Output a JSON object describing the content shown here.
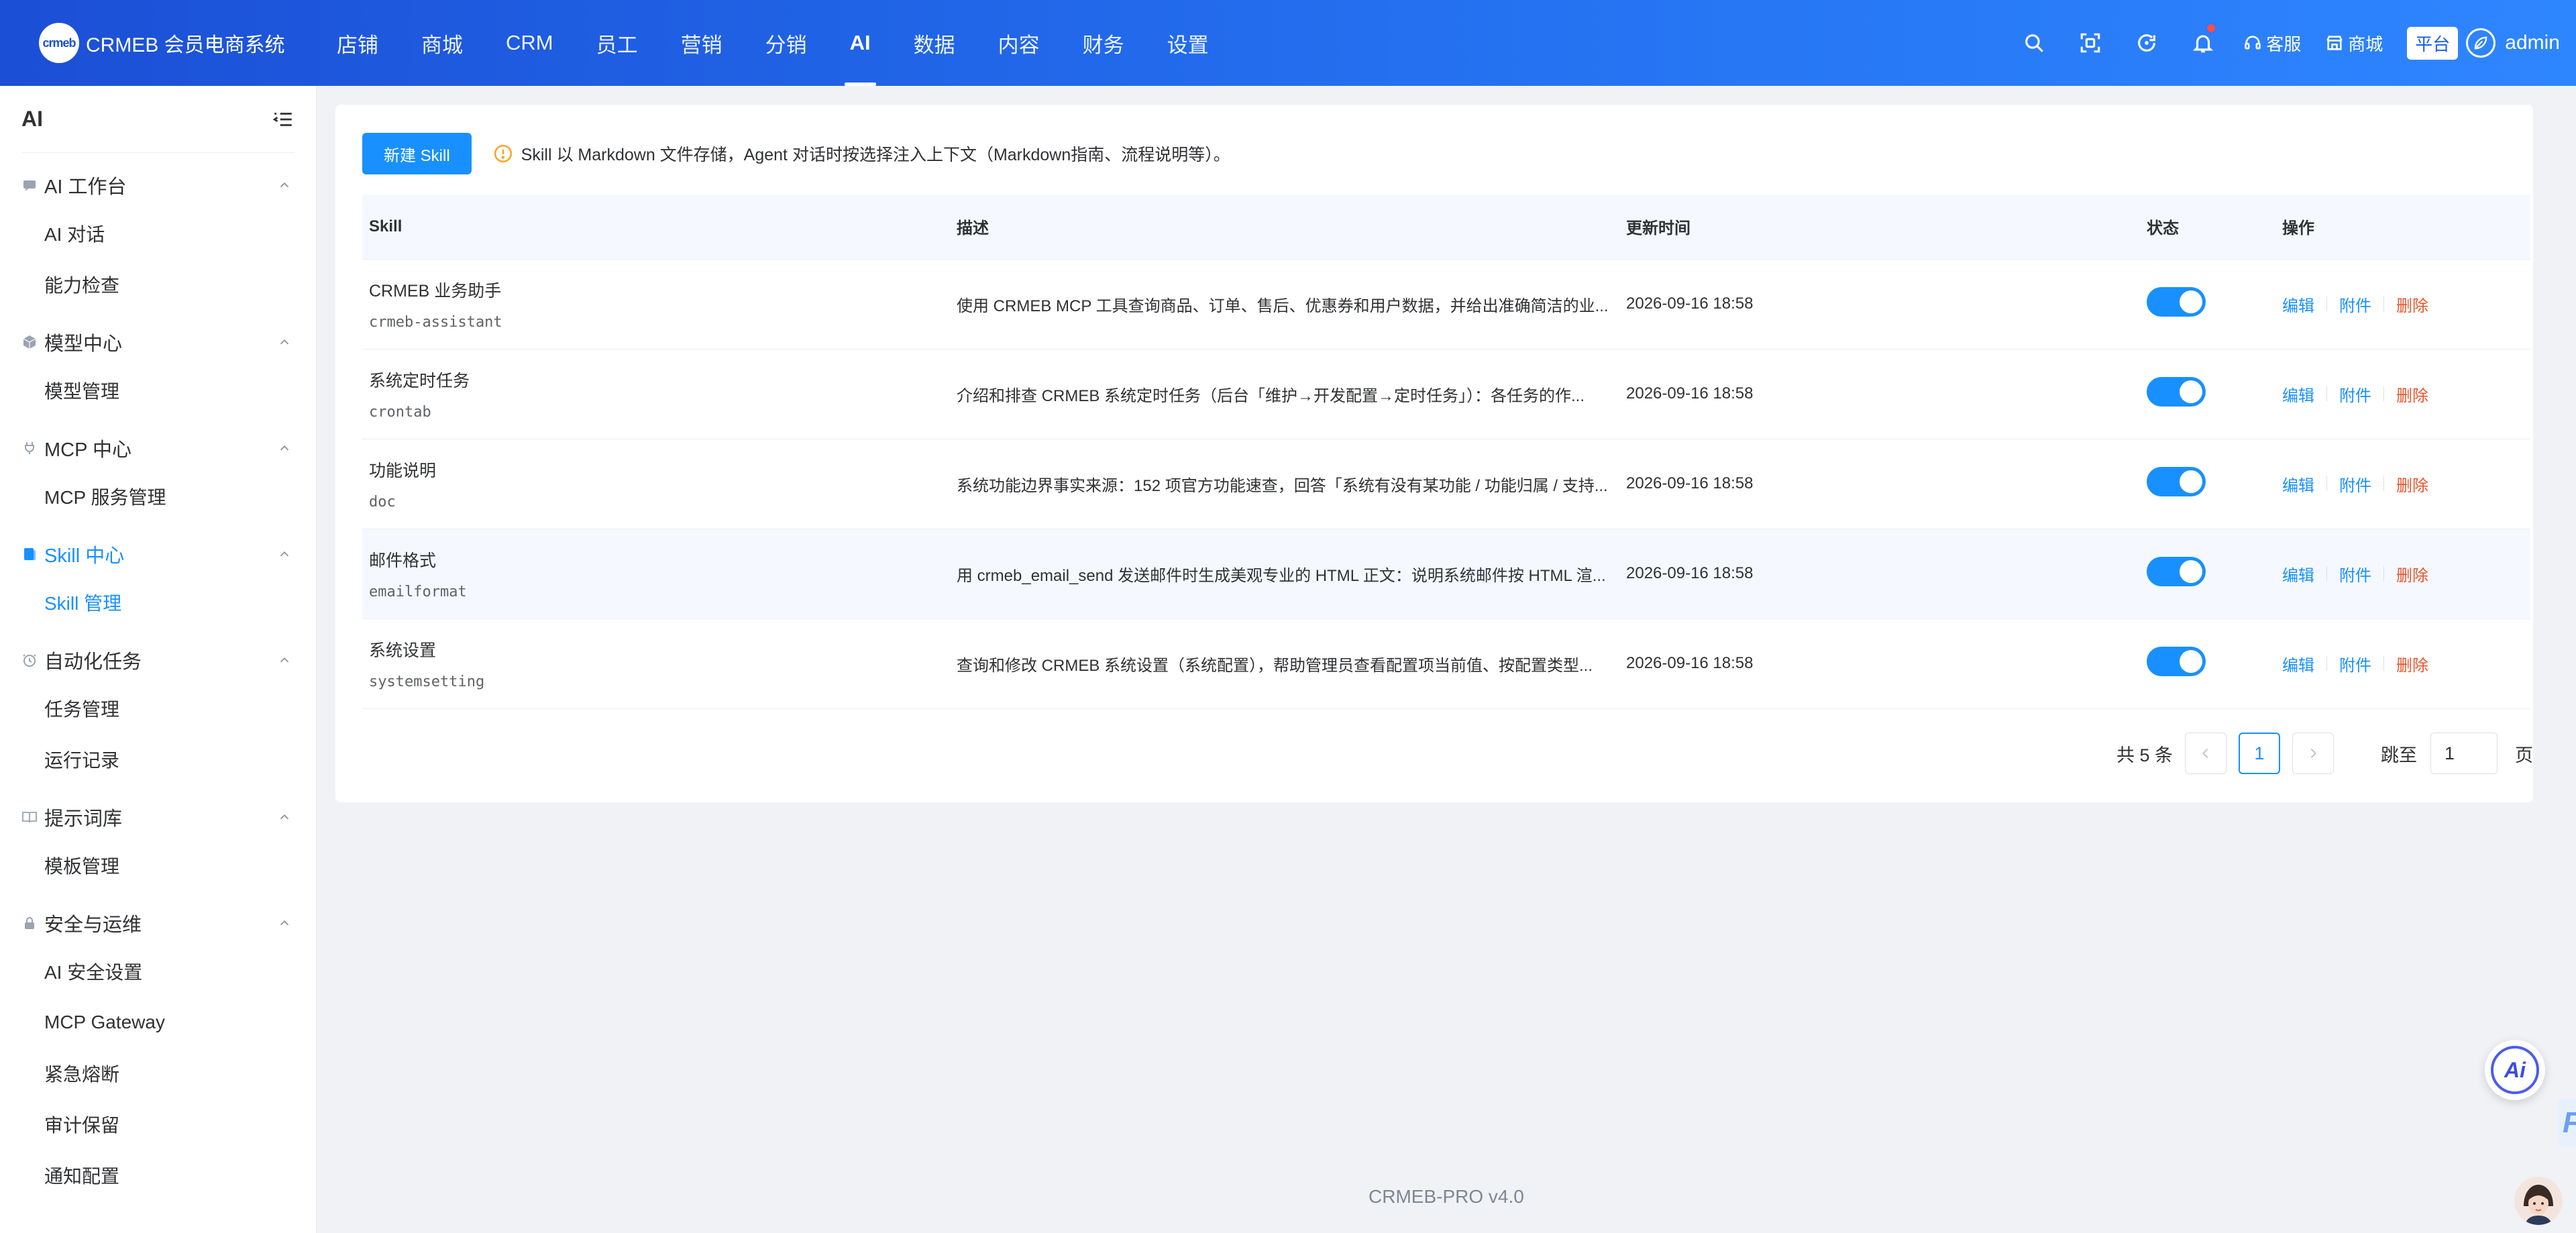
{
  "header": {
    "logo_text": "crmeb",
    "brand": "CRMEB 会员电商系统",
    "nav": [
      "店铺",
      "商城",
      "CRM",
      "员工",
      "营销",
      "分销",
      "AI",
      "数据",
      "内容",
      "财务",
      "设置"
    ],
    "active_nav": "AI",
    "service_label": "客服",
    "mall_label": "商城",
    "platform_label": "平台",
    "username": "admin"
  },
  "sidebar": {
    "title": "AI",
    "groups": [
      {
        "label": "AI 工作台",
        "icon": "chat-icon",
        "items": [
          "AI 对话",
          "能力检查"
        ]
      },
      {
        "label": "模型中心",
        "icon": "cube-icon",
        "items": [
          "模型管理"
        ]
      },
      {
        "label": "MCP 中心",
        "icon": "plug-icon",
        "items": [
          "MCP 服务管理"
        ]
      },
      {
        "label": "Skill 中心",
        "icon": "book-icon",
        "items": [
          "Skill 管理"
        ],
        "active": true
      },
      {
        "label": "自动化任务",
        "icon": "clock-icon",
        "items": [
          "任务管理",
          "运行记录"
        ]
      },
      {
        "label": "提示词库",
        "icon": "open-book-icon",
        "items": [
          "模板管理"
        ]
      },
      {
        "label": "安全与运维",
        "icon": "lock-icon",
        "items": [
          "AI 安全设置",
          "MCP Gateway",
          "紧急熔断",
          "审计保留",
          "通知配置"
        ]
      }
    ]
  },
  "toolbar": {
    "new_button": "新建 Skill",
    "tip": "Skill 以 Markdown 文件存储，Agent 对话时按选择注入上下文（Markdown指南、流程说明等）。"
  },
  "table": {
    "headers": [
      "Skill",
      "描述",
      "更新时间",
      "状态",
      "操作"
    ],
    "ops": [
      "编辑",
      "附件",
      "删除"
    ],
    "rows": [
      {
        "name": "CRMEB 业务助手",
        "code": "crmeb-assistant",
        "desc": "使用 CRMEB MCP 工具查询商品、订单、售后、优惠券和用户数据，并给出准确简洁的业...",
        "time": "2026-09-16 18:58",
        "enabled": true
      },
      {
        "name": "系统定时任务",
        "code": "crontab",
        "desc": "介绍和排查 CRMEB 系统定时任务（后台「维护→开发配置→定时任务」）：各任务的作...",
        "time": "2026-09-16 18:58",
        "enabled": true
      },
      {
        "name": "功能说明",
        "code": "doc",
        "desc": "系统功能边界事实来源：152 项官方功能速查，回答「系统有没有某功能 / 功能归属 / 支持...",
        "time": "2026-09-16 18:58",
        "enabled": true
      },
      {
        "name": "邮件格式",
        "code": "emailformat",
        "desc": "用 crmeb_email_send 发送邮件时生成美观专业的 HTML 正文：说明系统邮件按 HTML 渲...",
        "time": "2026-09-16 18:58",
        "enabled": true
      },
      {
        "name": "系统设置",
        "code": "systemsetting",
        "desc": "查询和修改 CRMEB 系统设置（系统配置），帮助管理员查看配置项当前值、按配置类型...",
        "time": "2026-09-16 18:58",
        "enabled": true
      }
    ]
  },
  "pagination": {
    "total_text": "共 5 条",
    "current_page": "1",
    "jump_label": "跳至",
    "jump_value": "1",
    "page_unit": "页"
  },
  "footer": {
    "version": "CRMEB-PRO v4.0"
  },
  "floating": {
    "ai_label": "Ai",
    "edge_label": "F"
  },
  "colors": {
    "primary": "#1890ff",
    "header_start": "#1b4fd6",
    "header_end": "#2e86ff",
    "danger_link": "#e8552c"
  }
}
